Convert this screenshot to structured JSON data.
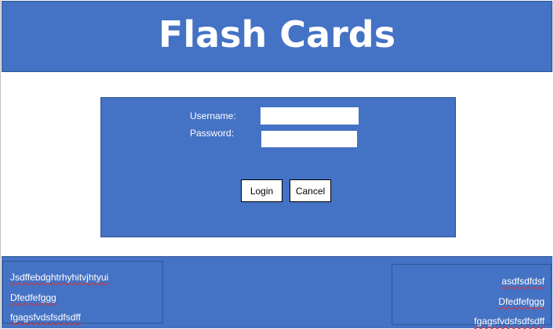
{
  "header": {
    "title": "Flash Cards"
  },
  "login": {
    "username_label": "Username:",
    "password_label": "Password:",
    "username_value": "",
    "password_value": "",
    "login_label": "Login",
    "cancel_label": "Cancel"
  },
  "footer": {
    "left": {
      "lines": [
        "Jsdffebdghtrhyhitvjhtyui",
        "Dfedfefggg",
        "fgagsfvdsfsdfsdff"
      ]
    },
    "right": {
      "lines": [
        "asdfsdfdsf",
        "Dfedfefggg",
        "fgagsfvdsfsdfsdff"
      ]
    }
  },
  "colors": {
    "primary_blue": "#4472c4",
    "border_blue": "#2f5597",
    "spellcheck_underline": "#e03030"
  }
}
